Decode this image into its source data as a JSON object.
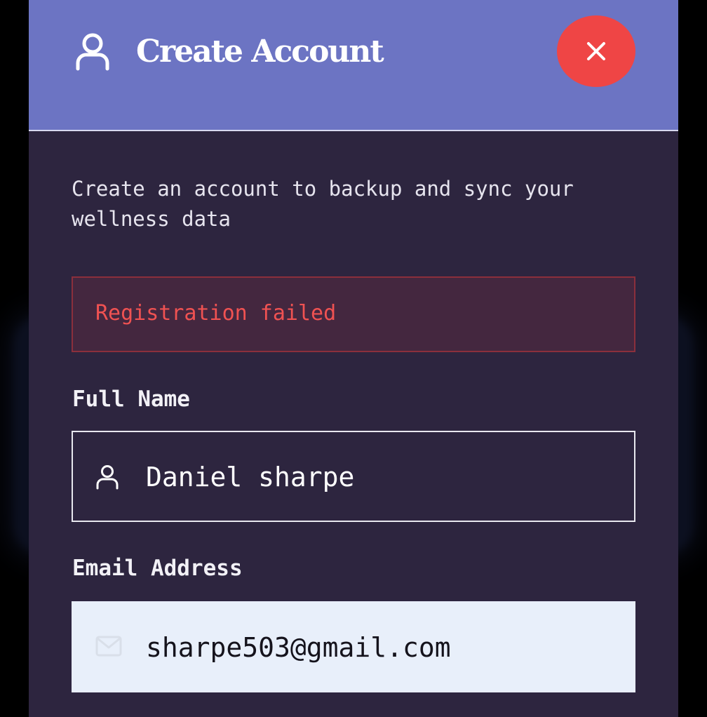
{
  "header": {
    "icon": "user-icon",
    "title": "Create Account",
    "close_icon": "close-icon",
    "background_color": "#6c74c3"
  },
  "description": "Create an account to backup and sync your wellness data",
  "error": {
    "message": "Registration failed",
    "color": "#f05252"
  },
  "form": {
    "full_name": {
      "label": "Full Name",
      "icon": "user-icon",
      "value": "Daniel sharpe"
    },
    "email": {
      "label": "Email Address",
      "icon": "mail-icon",
      "value": "sharpe503@gmail.com"
    }
  },
  "colors": {
    "modal_background": "#2d253f",
    "close_button": "#ef4545"
  }
}
